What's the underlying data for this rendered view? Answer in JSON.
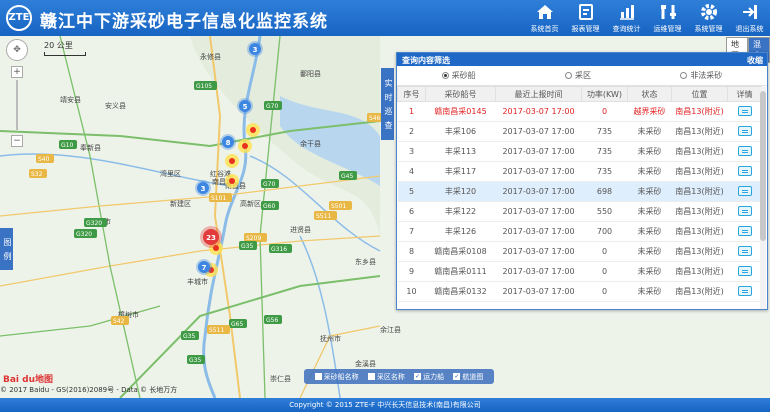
{
  "header": {
    "logo_text": "ZTE",
    "title": "赣江中下游采砂电子信息化监控系统",
    "nav": [
      {
        "label": "系统首页",
        "icon": "home-icon"
      },
      {
        "label": "报表管理",
        "icon": "report-icon"
      },
      {
        "label": "查询统计",
        "icon": "statistics-icon"
      },
      {
        "label": "运维管理",
        "icon": "tools-icon"
      },
      {
        "label": "系统管理",
        "icon": "gear-icon"
      },
      {
        "label": "退出系统",
        "icon": "logout-icon"
      }
    ]
  },
  "map": {
    "scale": "20 公里",
    "map_types": {
      "map": "地图",
      "hybrid": "混合"
    },
    "zoom": {
      "pan": "✥",
      "in": "+",
      "out": "−"
    },
    "labels": [
      "永修县",
      "安义县",
      "靖安县",
      "奉新县",
      "南昌县",
      "南昌市",
      "新建区",
      "丰城市",
      "樟树市",
      "进贤县",
      "高安市",
      "抚州市",
      "东乡县",
      "余江县",
      "金溪县",
      "红谷滩",
      "鄱阳县",
      "余干县",
      "高新区",
      "湾里区",
      "崇仁县"
    ],
    "road_labels": [
      "G105",
      "G70",
      "G60",
      "G320",
      "S101",
      "S209",
      "G316",
      "G35",
      "S42",
      "G56",
      "S40",
      "G45",
      "S46",
      "G65",
      "S511",
      "G35",
      "G35",
      "S501",
      "S511",
      "G320",
      "G10",
      "G70",
      "S32"
    ],
    "clusters": [
      {
        "count": "3",
        "color": "#3d86e2"
      },
      {
        "count": "5",
        "color": "#3d86e2"
      },
      {
        "count": "8",
        "color": "#3d86e2"
      },
      {
        "count": "3",
        "color": "#3d86e2"
      },
      {
        "count": "23",
        "color": "#e23b3b"
      },
      {
        "count": "7",
        "color": "#3d86e2"
      }
    ],
    "side_tab_query": "实时巡查",
    "side_tab_legend": "图例",
    "legend": [
      {
        "label": "采砂船名称",
        "checked": false
      },
      {
        "label": "采区名称",
        "checked": false
      },
      {
        "label": "运力船",
        "checked": true
      },
      {
        "label": "航道图",
        "checked": true
      }
    ],
    "baidu": "Bai du地图",
    "copyright": "© 2017 Baidu - GS(2016)2089号 - Data © 长地万方"
  },
  "panel": {
    "title": "查询内容筛选",
    "close": "收缩",
    "filters": [
      {
        "label": "采砂船",
        "selected": true
      },
      {
        "label": "采区",
        "selected": false
      },
      {
        "label": "非法采砂",
        "selected": false
      }
    ],
    "columns": [
      "序号",
      "采砂船号",
      "最近上报时间",
      "功率(KW)",
      "状态",
      "位置",
      "详情"
    ],
    "rows": [
      [
        "1",
        "赣南昌采0145",
        "2017-03-07 17:00",
        "0",
        "越界采砂",
        "南昌13(附近)"
      ],
      [
        "2",
        "丰采106",
        "2017-03-07 17:00",
        "735",
        "未采砂",
        "南昌13(附近)"
      ],
      [
        "3",
        "丰采113",
        "2017-03-07 17:00",
        "735",
        "未采砂",
        "南昌13(附近)"
      ],
      [
        "4",
        "丰采117",
        "2017-03-07 17:00",
        "735",
        "未采砂",
        "南昌13(附近)"
      ],
      [
        "5",
        "丰采120",
        "2017-03-07 17:00",
        "698",
        "未采砂",
        "南昌13(附近)"
      ],
      [
        "6",
        "丰采122",
        "2017-03-07 17:00",
        "550",
        "未采砂",
        "南昌13(附近)"
      ],
      [
        "7",
        "丰采126",
        "2017-03-07 17:00",
        "700",
        "未采砂",
        "南昌13(附近)"
      ],
      [
        "8",
        "赣南昌采0108",
        "2017-03-07 17:00",
        "0",
        "未采砂",
        "南昌13(附近)"
      ],
      [
        "9",
        "赣南昌采0111",
        "2017-03-07 17:00",
        "0",
        "未采砂",
        "南昌13(附近)"
      ],
      [
        "10",
        "赣南昌采0132",
        "2017-03-07 17:00",
        "0",
        "未采砂",
        "南昌13(附近)"
      ]
    ],
    "alert_status": "越界采砂",
    "selected_row": "5"
  },
  "footer": "Copyright © 2015 ZTE-F 中兴长天信息技术(南昌)有限公司",
  "colors": {
    "header": "#1f68c6",
    "alert": "#e02222",
    "river": "#8bbce8",
    "road": "#f2c86c",
    "highway": "#7bbf6a"
  }
}
